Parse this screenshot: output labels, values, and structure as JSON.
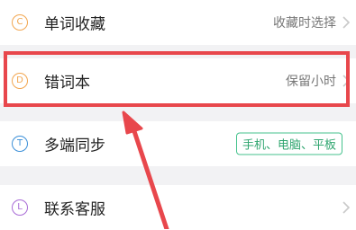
{
  "rows": [
    {
      "badge": "C",
      "label": "单词收藏",
      "value": "收藏时选择"
    },
    {
      "badge": "D",
      "label": "错词本",
      "value": "保留小时"
    },
    {
      "badge": "T",
      "label": "多端同步",
      "tag": "手机、电脑、平板"
    },
    {
      "badge": "L",
      "label": "联系客服"
    }
  ],
  "colors": {
    "badge_c": "#f2a64f",
    "badge_d": "#f2a64f",
    "badge_t": "#3b8fd8",
    "badge_l": "#a86bd6",
    "tag_green": "#45c28d",
    "annotation_red": "#e8474c",
    "background": "#f2f2f4"
  },
  "icons": {
    "chevron": "chevron-right-icon"
  }
}
